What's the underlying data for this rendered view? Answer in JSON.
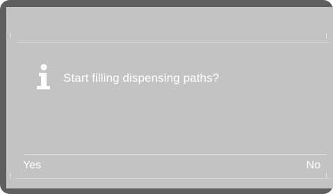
{
  "dialog": {
    "icon": "info-icon",
    "message": "Start filling dispensing paths?",
    "left_option": "Yes",
    "right_option": "No"
  },
  "colors": {
    "frame": "#5e5e5e",
    "screen": "#c3c3c3",
    "text": "#ffffff"
  }
}
